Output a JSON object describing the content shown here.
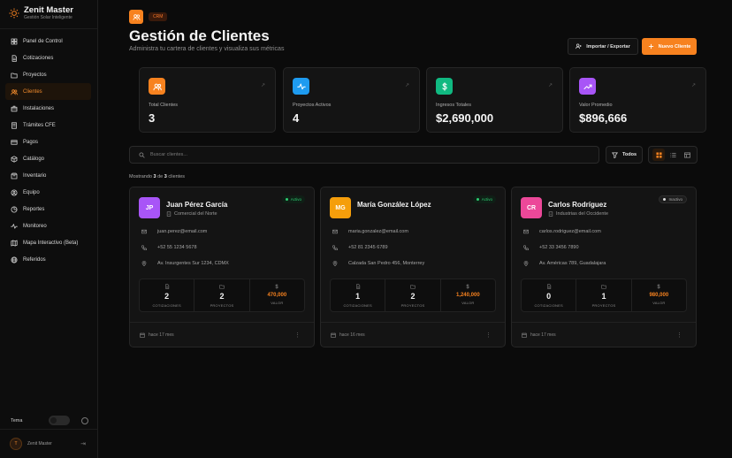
{
  "brand": {
    "title": "Zenit Master",
    "subtitle": "Gestión Solar Inteligente",
    "accent": "#f7821f"
  },
  "nav": [
    {
      "label": "Panel de Control",
      "icon": "grid-icon"
    },
    {
      "label": "Cotizaciones",
      "icon": "file-icon"
    },
    {
      "label": "Proyectos",
      "icon": "folder-icon"
    },
    {
      "label": "Clientes",
      "icon": "users-icon",
      "active": true
    },
    {
      "label": "Instalaciones",
      "icon": "tools-icon"
    },
    {
      "label": "Trámites CFE",
      "icon": "document-icon"
    },
    {
      "label": "Pagos",
      "icon": "card-icon"
    },
    {
      "label": "Catálogo",
      "icon": "package-icon"
    },
    {
      "label": "Inventario",
      "icon": "box-icon"
    },
    {
      "label": "Equipo",
      "icon": "team-icon"
    },
    {
      "label": "Reportes",
      "icon": "chart-icon"
    },
    {
      "label": "Monitoreo",
      "icon": "activity-icon"
    },
    {
      "label": "Mapa Interactivo (Beta)",
      "icon": "map-icon"
    },
    {
      "label": "Referidos",
      "icon": "globe-icon"
    }
  ],
  "theme": {
    "label": "Tema"
  },
  "user": {
    "initial": "T",
    "name": "Zenit Master"
  },
  "header": {
    "badge": "CRM",
    "title": "Gestión de Clientes",
    "subtitle": "Administra tu cartera de clientes y visualiza sus métricas",
    "export_label": "Importar / Exportar",
    "new_label": "Nuevo Cliente"
  },
  "stats": [
    {
      "label": "Total Clientes",
      "value": "3",
      "color": "#f7821f",
      "icon": "users-icon"
    },
    {
      "label": "Proyectos Activos",
      "value": "4",
      "color": "#1e9bf0",
      "icon": "activity-icon"
    },
    {
      "label": "Ingresos Totales",
      "value": "$2,690,000",
      "color": "#10b981",
      "icon": "dollar-icon"
    },
    {
      "label": "Valor Promedio",
      "value": "$896,666",
      "color": "#a855f7",
      "icon": "trending-up-icon"
    }
  ],
  "search": {
    "placeholder": "Buscar clientes..."
  },
  "filter": {
    "label": "Todos"
  },
  "showing": {
    "prefix": "Mostrando",
    "shown": "3",
    "middle": "de",
    "total": "3",
    "suffix": "clientes"
  },
  "clients": [
    {
      "initials": "JP",
      "name": "Juan Pérez García",
      "company": "Comercial del Norte",
      "status": "Activo",
      "active": true,
      "email": "juan.perez@email.com",
      "phone": "+52 55 1234 5678",
      "address": "Av. Insurgentes Sur 1234, CDMX",
      "quotes": "2",
      "projects": "2",
      "value": "470,000",
      "since": "hace 17 mes",
      "color": "#a855f7"
    },
    {
      "initials": "MG",
      "name": "María González López",
      "company": "",
      "status": "Activo",
      "active": true,
      "email": "maria.gonzalez@email.com",
      "phone": "+52 81 2345 6789",
      "address": "Calzada San Pedro 456, Monterrey",
      "quotes": "1",
      "projects": "2",
      "value": "1,240,000",
      "since": "hace 16 mes",
      "color": "#f59e0b"
    },
    {
      "initials": "CR",
      "name": "Carlos Rodríguez",
      "company": "Industrias del Occidente",
      "status": "Inactivo",
      "active": false,
      "email": "carlos.rodriguez@email.com",
      "phone": "+52 33 3456 7890",
      "address": "Av. Américas 789, Guadalajara",
      "quotes": "0",
      "projects": "1",
      "value": "980,000",
      "since": "hace 17 mes",
      "color": "#ec4899"
    }
  ],
  "metric_labels": {
    "quotes": "COTIZACIONES",
    "projects": "PROYECTOS",
    "value": "VALOR"
  }
}
